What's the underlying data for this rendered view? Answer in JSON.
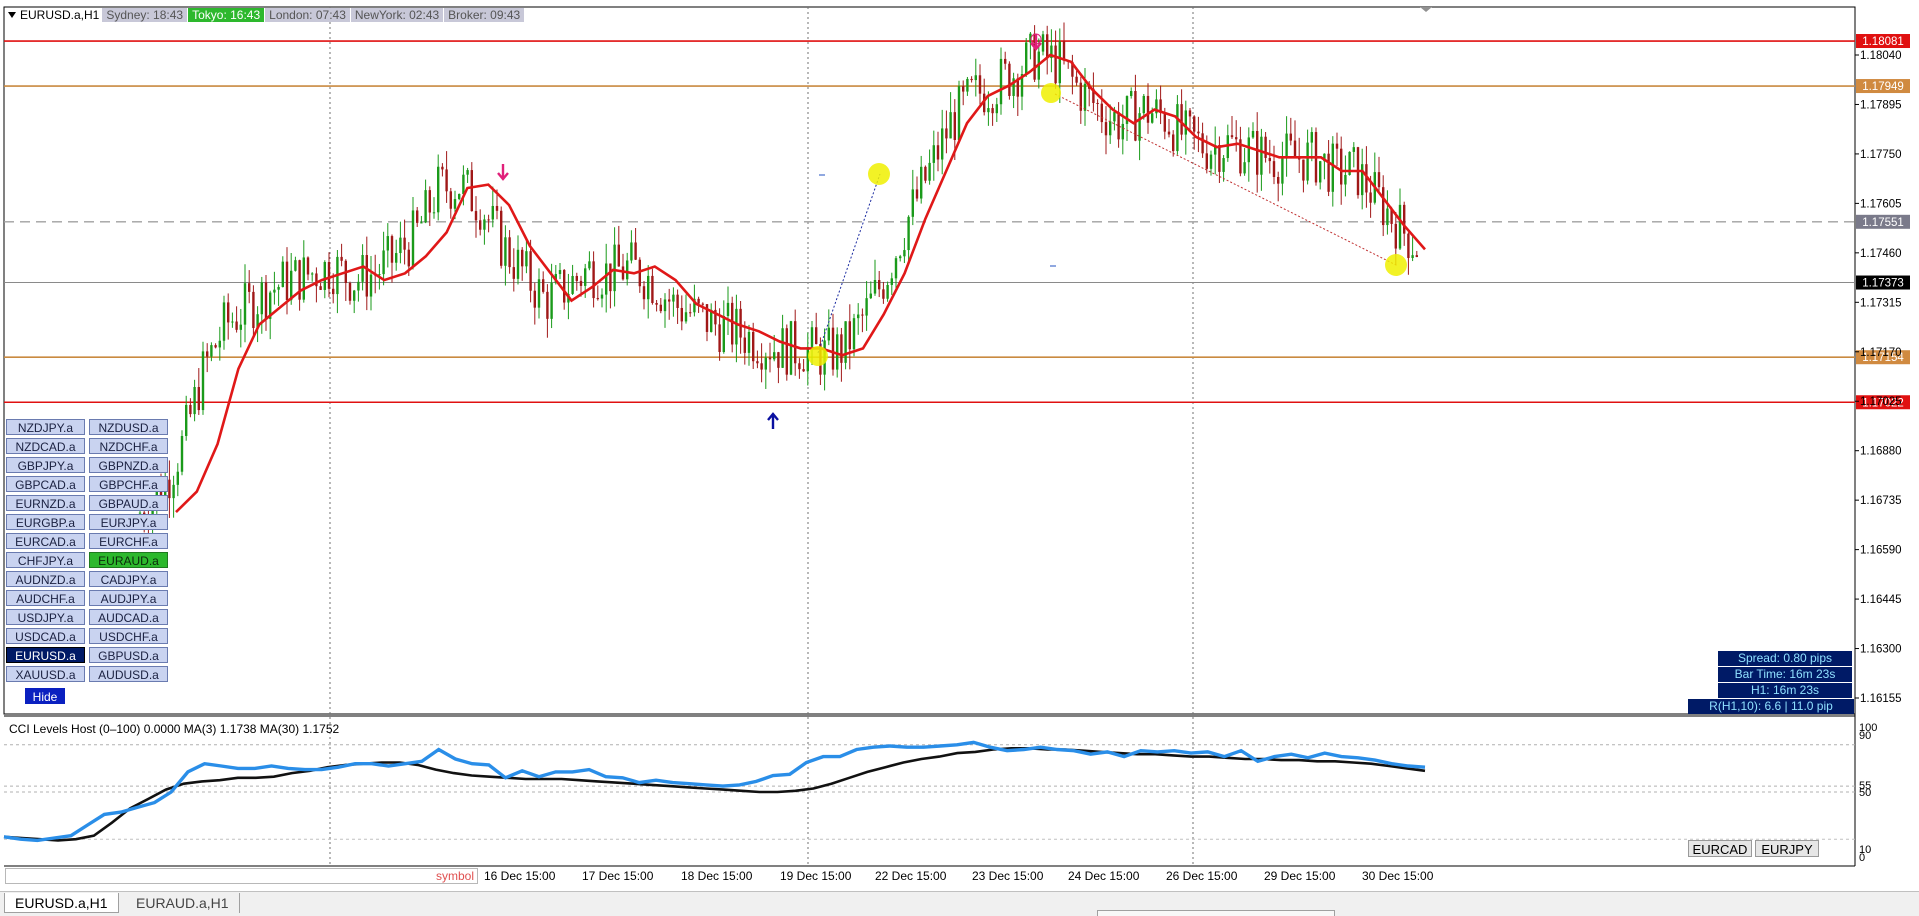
{
  "window": {
    "symbol_title": "EURUSD.a,H1"
  },
  "sessions": [
    {
      "label": "Sydney: 18:43",
      "color": "#c8c8d8",
      "active": false
    },
    {
      "label": "Tokyo: 16:43",
      "color": "#2db82d",
      "active": true
    },
    {
      "label": "London: 07:43",
      "color": "#c8c8d8",
      "active": false
    },
    {
      "label": "NewYork: 02:43",
      "color": "#c8c8d8",
      "active": false
    },
    {
      "label": "Broker: 09:43",
      "color": "#c8c8d8",
      "active": false
    }
  ],
  "price_axis": {
    "ticks": [
      "1.18040",
      "1.17895",
      "1.17750",
      "1.17605",
      "1.17460",
      "1.17315",
      "1.17170",
      "1.17025",
      "1.16880",
      "1.16735",
      "1.16590",
      "1.16445",
      "1.16300",
      "1.16155"
    ],
    "min": 1.1605,
    "max": 1.1818
  },
  "levels": [
    {
      "price": 1.18081,
      "label": "1.18081",
      "color": "#e01010",
      "style": "solid",
      "tag_bg": "#e01010"
    },
    {
      "price": 1.17949,
      "label": "1.17949",
      "color": "#c98a40",
      "style": "solid",
      "tag_bg": "#d08a40"
    },
    {
      "price": 1.17551,
      "label": "1.17551",
      "color": "#a0a0a0",
      "style": "dashed",
      "tag_bg": "#7a7a8a"
    },
    {
      "price": 1.17373,
      "label": "1.17373",
      "color": "#8a8a8a",
      "style": "thin",
      "tag_bg": "#000000"
    },
    {
      "price": 1.17154,
      "label": "1.17154",
      "color": "#c98a40",
      "style": "solid",
      "tag_bg": "#d08a40"
    },
    {
      "price": 1.17022,
      "label": "1.17022",
      "color": "#e01010",
      "style": "solid",
      "tag_bg": "#e01010"
    }
  ],
  "time_axis": {
    "labels": [
      "16 Dec 15:00",
      "17 Dec 15:00",
      "18 Dec 15:00",
      "19 Dec 15:00",
      "22 Dec 15:00",
      "23 Dec 15:00",
      "24 Dec 15:00",
      "26 Dec 15:00",
      "29 Dec 15:00",
      "30 Dec 15:00"
    ],
    "symbol_placeholder": "symbol"
  },
  "symbol_buttons": {
    "col1": [
      "NZDJPY.a",
      "NZDCAD.a",
      "GBPJPY.a",
      "GBPCAD.a",
      "EURNZD.a",
      "EURGBP.a",
      "EURCAD.a",
      "CHFJPY.a",
      "AUDNZD.a",
      "AUDCHF.a",
      "USDJPY.a",
      "USDCAD.a",
      "EURUSD.a",
      "XAUUSD.a"
    ],
    "col2": [
      "NZDUSD.a",
      "NZDCHF.a",
      "GBPNZD.a",
      "GBPCHF.a",
      "GBPAUD.a",
      "EURJPY.a",
      "EURCHF.a",
      "EURAUD.a",
      "CADJPY.a",
      "AUDJPY.a",
      "AUDCAD.a",
      "USDCHF.a",
      "GBPUSD.a",
      "AUDUSD.a"
    ],
    "selected": "EURUSD.a",
    "active": "EURAUD.a",
    "hide_label": "Hide"
  },
  "info_panel": {
    "spread": "Spread: 0.80 pips",
    "bar_time": "Bar Time: 16m 23s",
    "h1": "H1:  16m 23s",
    "range": "R(H1,10): 6.6  |  11.0 pip"
  },
  "indicator": {
    "title": "CCI Levels Host (0–100) 0.0000  MA(3) 1.1738  MA(30) 1.1752",
    "ticks": [
      "100",
      "90",
      "55",
      "50",
      "10",
      "0"
    ],
    "min": 0,
    "max": 100
  },
  "quick_buttons": [
    "EURCAD",
    "EURJPY"
  ],
  "tabs": [
    {
      "label": "EURUSD.a,H1",
      "active": true
    },
    {
      "label": "EURAUD.a,H1",
      "active": false
    }
  ],
  "colors": {
    "ma_price": "#e01818",
    "bull": "#1a9a1a",
    "bear": "#a01818",
    "cci_ma3": "#2a8ee8",
    "cci_ma30": "#111111",
    "arrow_up": "#0a10a0",
    "arrow_down": "#e0207a",
    "marker": "#f0f000"
  },
  "chart_data": {
    "type": "candlestick",
    "timeframe": "H1",
    "x_labels": [
      "16 Dec 15:00",
      "17 Dec 15:00",
      "18 Dec 15:00",
      "19 Dec 15:00",
      "22 Dec 15:00",
      "23 Dec 15:00",
      "24 Dec 15:00",
      "26 Dec 15:00",
      "29 Dec 15:00",
      "30 Dec 15:00"
    ],
    "price_ma": [
      1.167,
      1.1676,
      1.169,
      1.1712,
      1.1725,
      1.173,
      1.1735,
      1.1738,
      1.174,
      1.1742,
      1.1738,
      1.174,
      1.1745,
      1.1752,
      1.1765,
      1.1766,
      1.176,
      1.1748,
      1.174,
      1.1732,
      1.1736,
      1.1741,
      1.174,
      1.1742,
      1.1738,
      1.1731,
      1.1728,
      1.1725,
      1.1723,
      1.172,
      1.1718,
      1.1718,
      1.1716,
      1.1718,
      1.1728,
      1.174,
      1.1756,
      1.177,
      1.1784,
      1.1792,
      1.1795,
      1.1799,
      1.1804,
      1.1802,
      1.1794,
      1.1788,
      1.1784,
      1.1788,
      1.1786,
      1.178,
      1.1777,
      1.1778,
      1.1776,
      1.1774,
      1.1774,
      1.1774,
      1.177,
      1.177,
      1.1762,
      1.1754,
      1.1747
    ],
    "cci_ma3": [
      12,
      10,
      9,
      11,
      13,
      22,
      31,
      33,
      37,
      41,
      50,
      67,
      74,
      72,
      70,
      70,
      72,
      70,
      69,
      69,
      71,
      74,
      74,
      72,
      74,
      76,
      86,
      78,
      74,
      73,
      62,
      68,
      63,
      67,
      67,
      69,
      63,
      62,
      58,
      60,
      58,
      57,
      56,
      55,
      56,
      59,
      64,
      65,
      75,
      80,
      80,
      86,
      88,
      89,
      88,
      88,
      89,
      90,
      92,
      88,
      85,
      86,
      88,
      86,
      85,
      82,
      84,
      80,
      85,
      84,
      85,
      83,
      84,
      80,
      85,
      76,
      80,
      82,
      79,
      83,
      80,
      79,
      77,
      74,
      72,
      71
    ],
    "cci_ma30": [
      12,
      11,
      10,
      9,
      10,
      13,
      24,
      36,
      44,
      52,
      57,
      59,
      60,
      62,
      62,
      63,
      66,
      68,
      71,
      73,
      74,
      75,
      75,
      73,
      69,
      66,
      64,
      63,
      62,
      61,
      61,
      61,
      60,
      59,
      58,
      57,
      56,
      55,
      54,
      53,
      52,
      51,
      50,
      50,
      51,
      53,
      57,
      62,
      67,
      71,
      75,
      78,
      80,
      83,
      84,
      86,
      87,
      87,
      86,
      86,
      85,
      84,
      83,
      82,
      82,
      81,
      80,
      80,
      79,
      78,
      78,
      77,
      77,
      76,
      76,
      75,
      74,
      72,
      70,
      68
    ],
    "price_ylim": [
      1.1605,
      1.1818
    ],
    "indicator_ylim": [
      0,
      100
    ]
  }
}
